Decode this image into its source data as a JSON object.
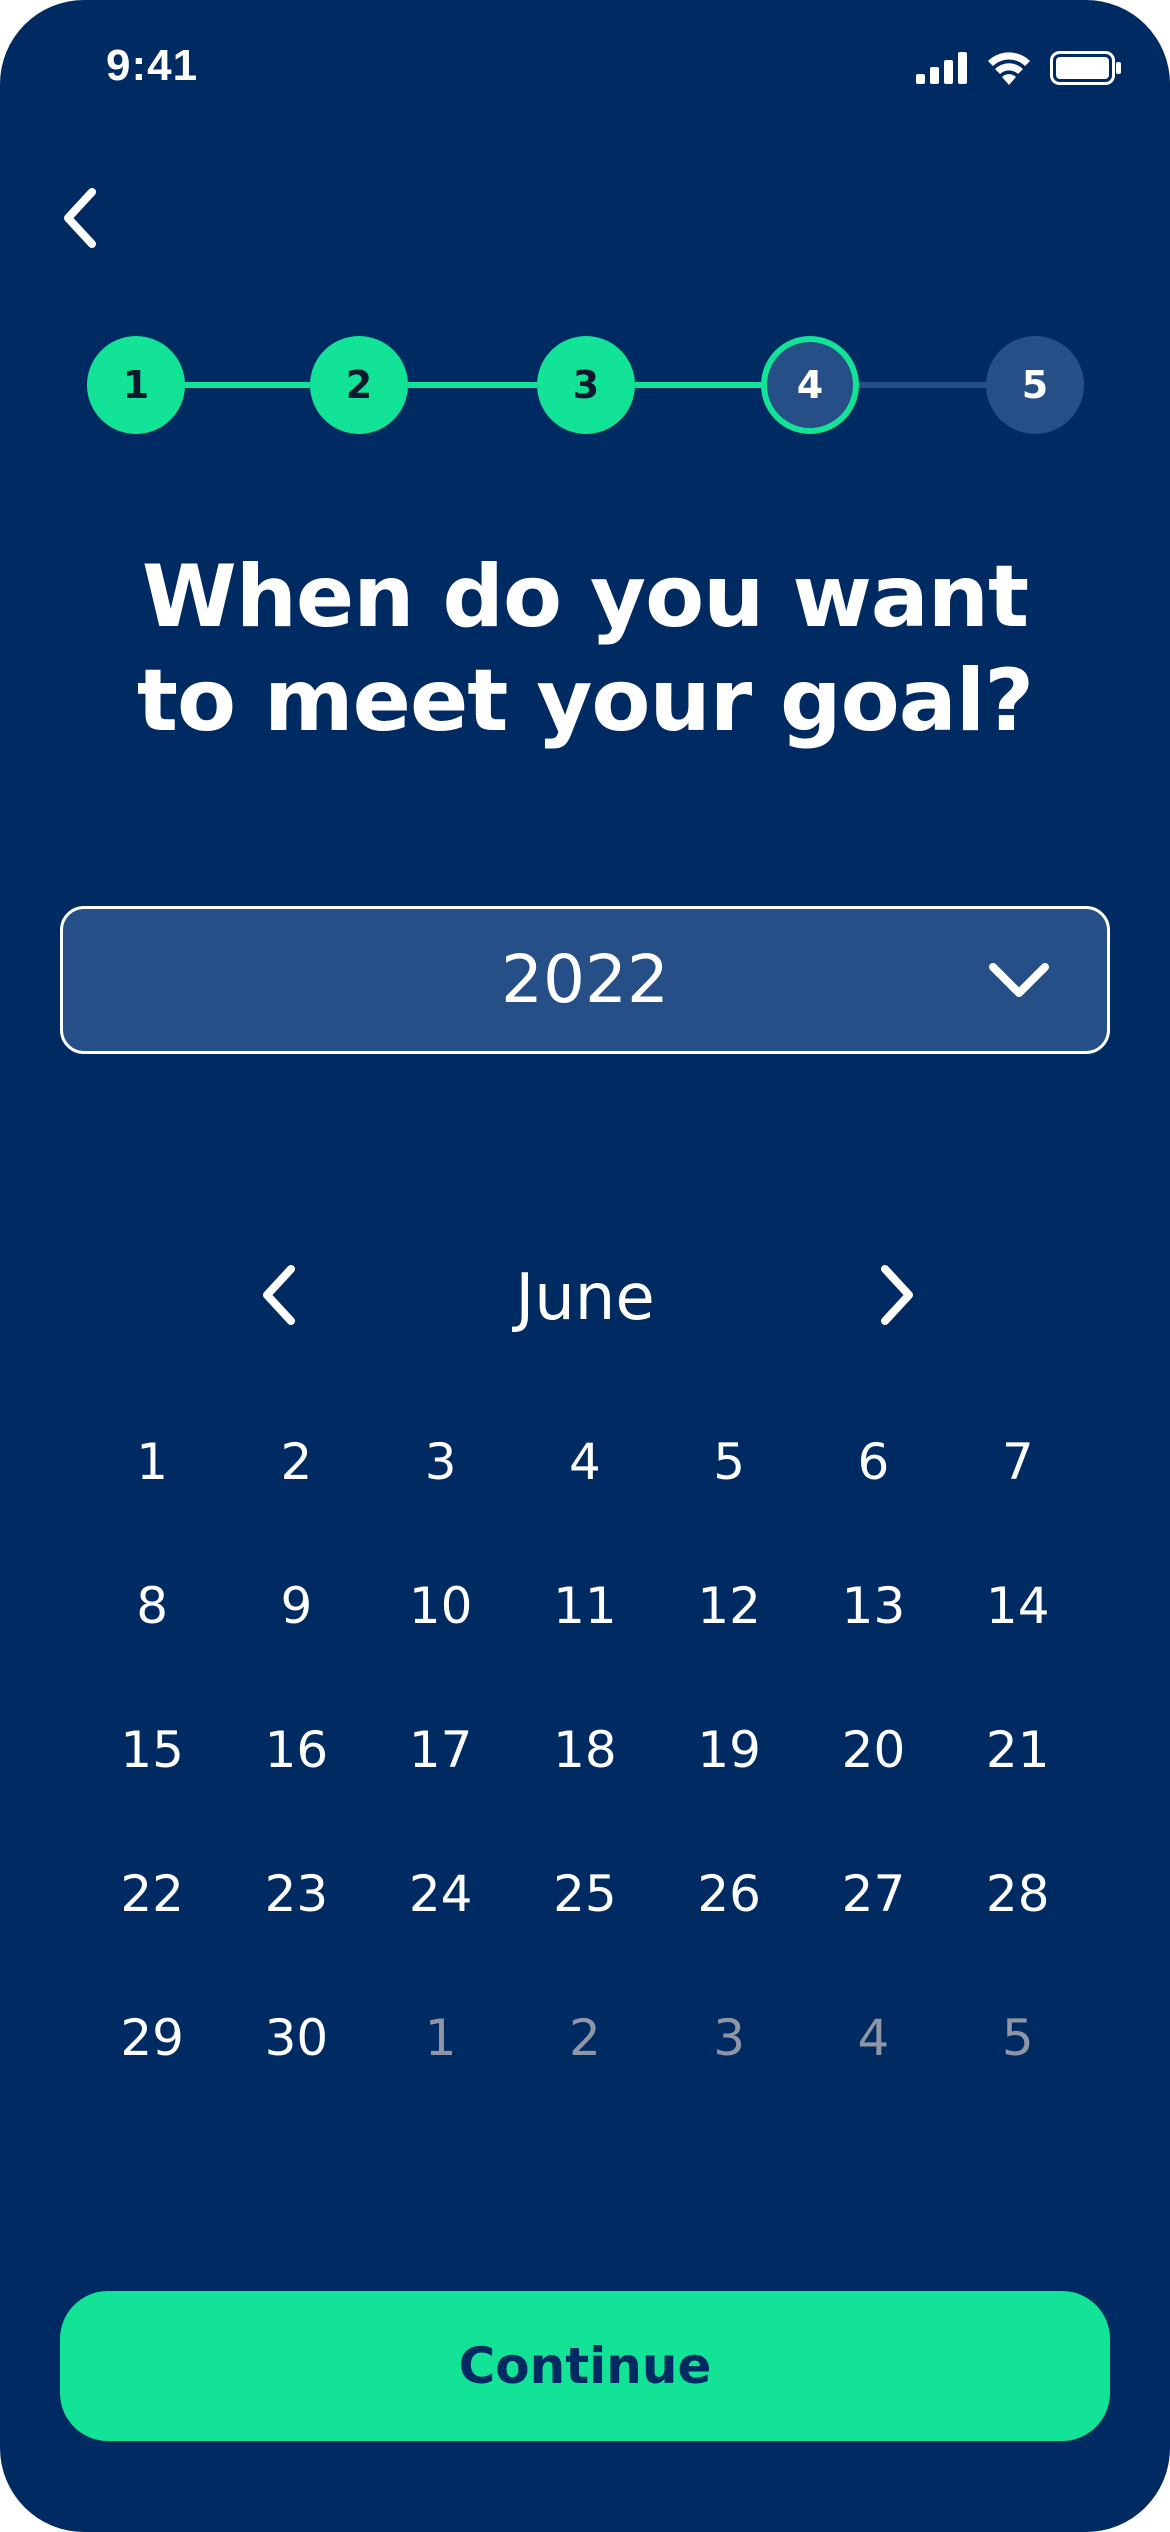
{
  "status_bar": {
    "time": "9:41",
    "icons": [
      "cellular-signal-icon",
      "wifi-icon",
      "battery-icon"
    ]
  },
  "nav": {
    "back_icon": "chevron-left-icon"
  },
  "stepper": {
    "steps": [
      {
        "label": "1",
        "state": "done"
      },
      {
        "label": "2",
        "state": "done"
      },
      {
        "label": "3",
        "state": "done"
      },
      {
        "label": "4",
        "state": "current"
      },
      {
        "label": "5",
        "state": "todo"
      }
    ],
    "current_step": 4,
    "total_steps": 5
  },
  "heading": {
    "line1": "When do you want",
    "line2": "to meet your goal?"
  },
  "year_select": {
    "value": "2022",
    "icon": "chevron-down-icon"
  },
  "calendar": {
    "month": "June",
    "prev_icon": "chevron-left-icon",
    "next_icon": "chevron-right-icon",
    "weeks": [
      [
        {
          "d": "1"
        },
        {
          "d": "2"
        },
        {
          "d": "3"
        },
        {
          "d": "4"
        },
        {
          "d": "5"
        },
        {
          "d": "6"
        },
        {
          "d": "7"
        }
      ],
      [
        {
          "d": "8"
        },
        {
          "d": "9"
        },
        {
          "d": "10"
        },
        {
          "d": "11"
        },
        {
          "d": "12"
        },
        {
          "d": "13"
        },
        {
          "d": "14"
        }
      ],
      [
        {
          "d": "15"
        },
        {
          "d": "16"
        },
        {
          "d": "17"
        },
        {
          "d": "18"
        },
        {
          "d": "19"
        },
        {
          "d": "20"
        },
        {
          "d": "21"
        }
      ],
      [
        {
          "d": "22"
        },
        {
          "d": "23"
        },
        {
          "d": "24"
        },
        {
          "d": "25"
        },
        {
          "d": "26"
        },
        {
          "d": "27"
        },
        {
          "d": "28"
        }
      ],
      [
        {
          "d": "29"
        },
        {
          "d": "30"
        },
        {
          "d": "1",
          "outside": true
        },
        {
          "d": "2",
          "outside": true
        },
        {
          "d": "3",
          "outside": true
        },
        {
          "d": "4",
          "outside": true
        },
        {
          "d": "5",
          "outside": true
        }
      ]
    ]
  },
  "continue_button": {
    "label": "Continue"
  },
  "colors": {
    "background": "#002A62",
    "accent": "#13E396",
    "panel": "#254F86",
    "muted_text": "#8F97A6",
    "text": "#FFFFFF"
  }
}
